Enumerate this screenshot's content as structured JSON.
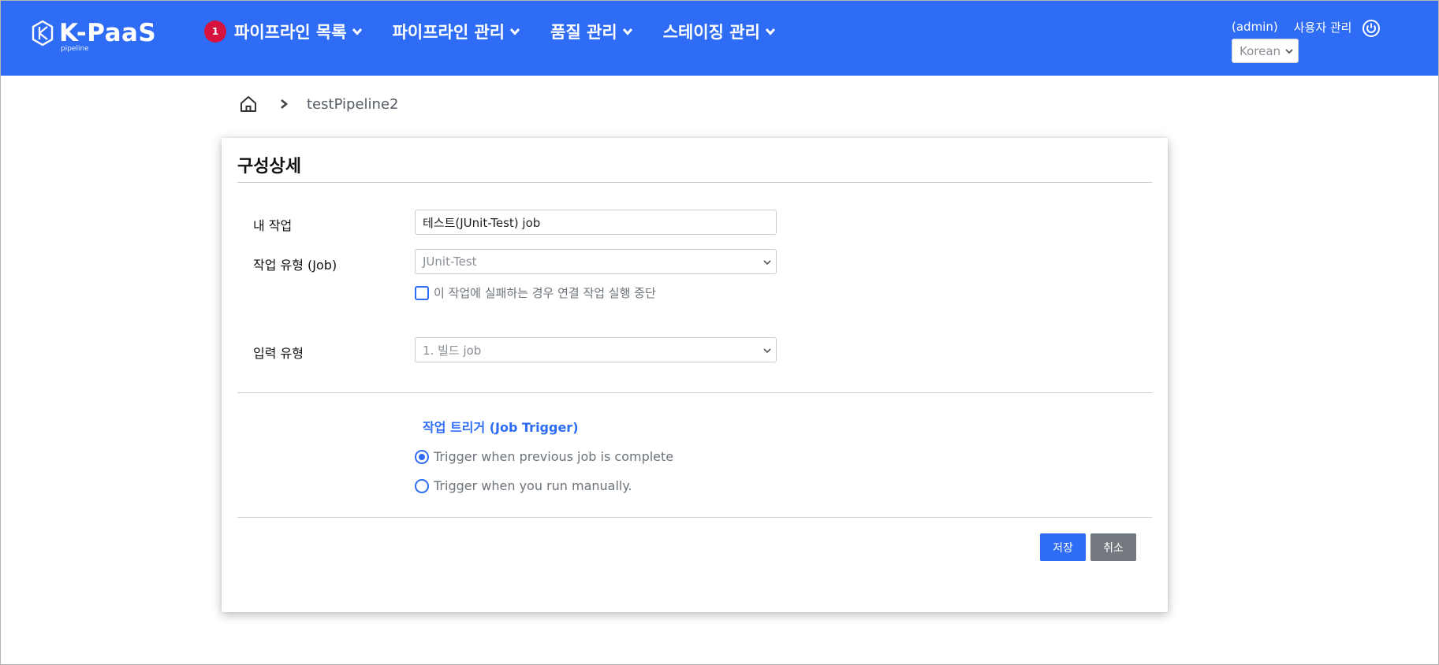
{
  "brand": {
    "name": "K-PaaS",
    "subtitle": "pipeline"
  },
  "nav": {
    "badge_count": "1",
    "items": [
      {
        "label": "파이프라인 목록"
      },
      {
        "label": "파이프라인 관리"
      },
      {
        "label": "품질 관리"
      },
      {
        "label": "스테이징 관리"
      }
    ]
  },
  "header_right": {
    "user": "(admin)",
    "user_management": "사용자 관리",
    "language": "Korean",
    "power_icon": "power-icon"
  },
  "breadcrumb": {
    "home_icon": "home-icon",
    "current": "testPipeline2"
  },
  "form": {
    "title": "구성상세",
    "my_job_label": "내 작업",
    "my_job_value": "테스트(JUnit-Test) job",
    "job_type_label": "작업 유형 (Job)",
    "job_type_value": "JUnit-Test",
    "stop_on_fail_label": "이 작업에 실패하는 경우 연결 작업 실행 중단",
    "stop_on_fail_checked": false,
    "input_type_label": "입력 유형",
    "input_type_value": "1. 빌드 job",
    "trigger_title": "작업 트리거 (Job Trigger)",
    "trigger_options": [
      {
        "label": "Trigger when previous job is complete",
        "checked": true
      },
      {
        "label": "Trigger when you run manually.",
        "checked": false
      }
    ],
    "save_label": "저장",
    "cancel_label": "취소"
  },
  "colors": {
    "primary": "#2f6cf6",
    "badge": "#d6123f",
    "cancel": "#74797f"
  }
}
